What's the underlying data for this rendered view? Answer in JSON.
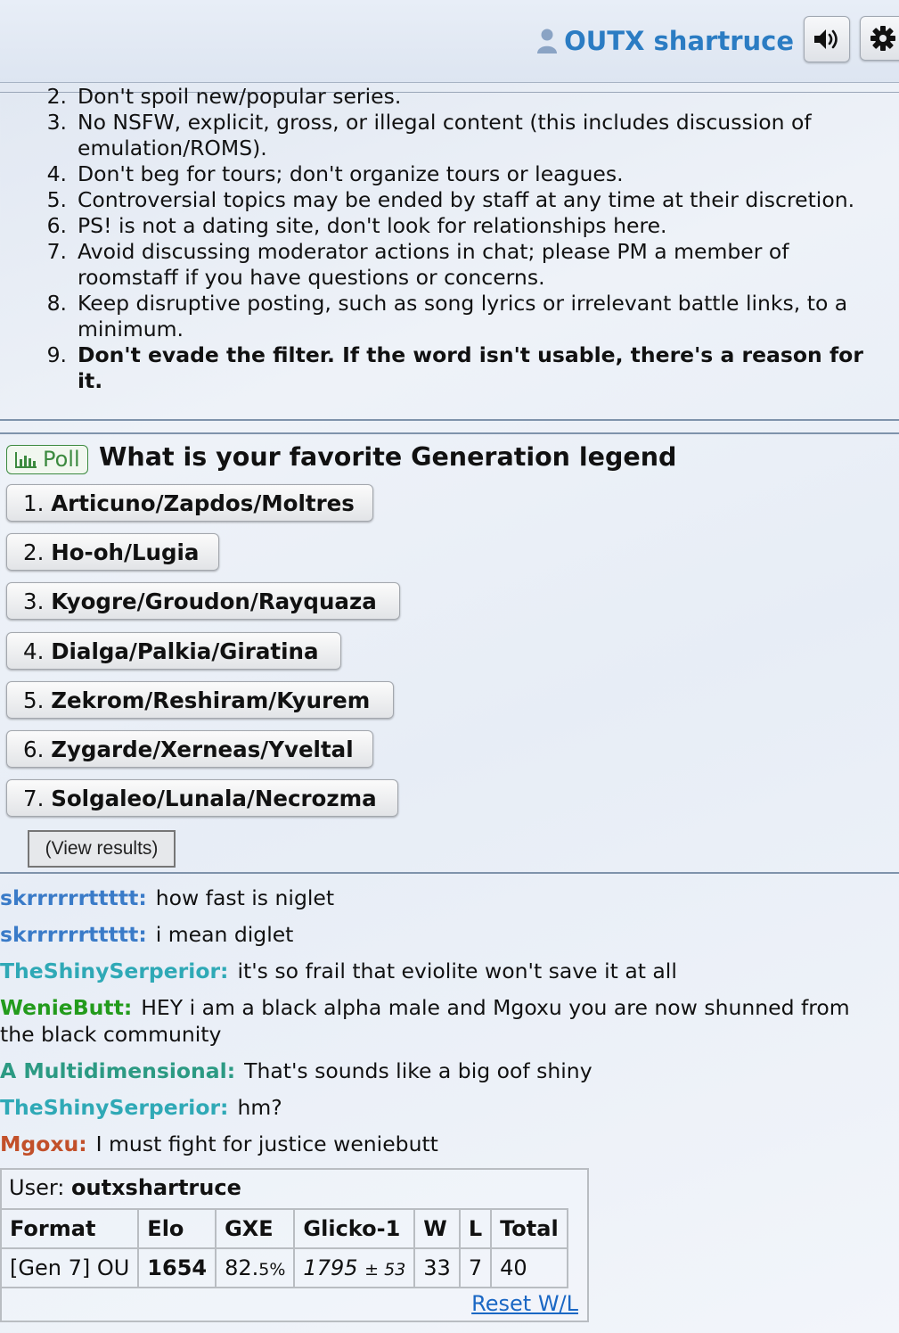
{
  "header": {
    "username": "OUTX shartruce",
    "icons": {
      "user": "user-icon",
      "sound": "sound-icon",
      "settings": "gear-icon"
    }
  },
  "rules": {
    "items": [
      {
        "number": "2.",
        "text": "Don't spoil new/popular series."
      },
      {
        "number": "3.",
        "text": "No NSFW, explicit, gross, or illegal content (this includes discussion of",
        "text2": "emulation/ROMS)."
      },
      {
        "number": "4.",
        "text": "Don't beg for tours; don't organize tours or leagues."
      },
      {
        "number": "5.",
        "text": "Controversial topics may be ended by staff at any time at their discretion."
      },
      {
        "number": "6.",
        "text": "PS! is not a dating site, don't look for relationships here."
      },
      {
        "number": "7.",
        "text": "Avoid discussing moderator actions in chat; please PM a member of",
        "text2": "roomstaff if you have questions or concerns."
      },
      {
        "number": "8.",
        "text": "Keep disruptive posting, such as song lyrics or irrelevant battle links, to a",
        "text2": "minimum."
      },
      {
        "number": "9.",
        "text": "Don't evade the filter. If the word isn't usable, there's a reason for",
        "text2": "it."
      }
    ]
  },
  "poll": {
    "tag": "Poll",
    "title": "What is your favorite Generation legend",
    "options": [
      {
        "num": "1.",
        "label": "Articuno/Zapdos/Moltres"
      },
      {
        "num": "2.",
        "label": "Ho-oh/Lugia"
      },
      {
        "num": "3.",
        "label": "Kyogre/Groudon/Rayquaza"
      },
      {
        "num": "4.",
        "label": "Dialga/Palkia/Giratina"
      },
      {
        "num": "5.",
        "label": "Zekrom/Reshiram/Kyurem"
      },
      {
        "num": "6.",
        "label": "Zygarde/Xerneas/Yveltal"
      },
      {
        "num": "7.",
        "label": "Solgaleo/Lunala/Necrozma"
      }
    ],
    "view_results": "(View results)"
  },
  "chat": [
    {
      "user": "skrrrrrrttttt:",
      "color": "#3a7bc8",
      "message": "how fast is niglet"
    },
    {
      "user": "skrrrrrrttttt:",
      "color": "#3a7bc8",
      "message": "i mean diglet"
    },
    {
      "user": "TheShinySerperior:",
      "color": "#2fa9b6",
      "message": "it's so frail that eviolite won't save it at all"
    },
    {
      "user": "WenieButt:",
      "color": "#239b1c",
      "message": "HEY i am a black alpha male and Mgoxu you are now shunned from",
      "message2": "the black community"
    },
    {
      "user": "A Multidimensional:",
      "color": "#2c9a83",
      "message": "That's sounds like a big oof shiny"
    },
    {
      "user": "TheShinySerperior:",
      "color": "#2fa9b6",
      "message": "hm?"
    },
    {
      "user": "Mgoxu:",
      "color": "#c2502a",
      "message": "I must fight for justice weniebutt"
    }
  ],
  "rank": {
    "user_label": "User:",
    "user": "outxshartruce",
    "headers": [
      "Format",
      "Elo",
      "GXE",
      "Glicko-1",
      "W",
      "L",
      "Total"
    ],
    "row": {
      "format": "[Gen 7] OU",
      "elo": "1654",
      "gxe_main": "82.",
      "gxe_small": "5%",
      "glicko_main": "1795",
      "glicko_small": "± 53",
      "w": "33",
      "l": "7",
      "total": "40"
    },
    "reset": "Reset W/L"
  }
}
